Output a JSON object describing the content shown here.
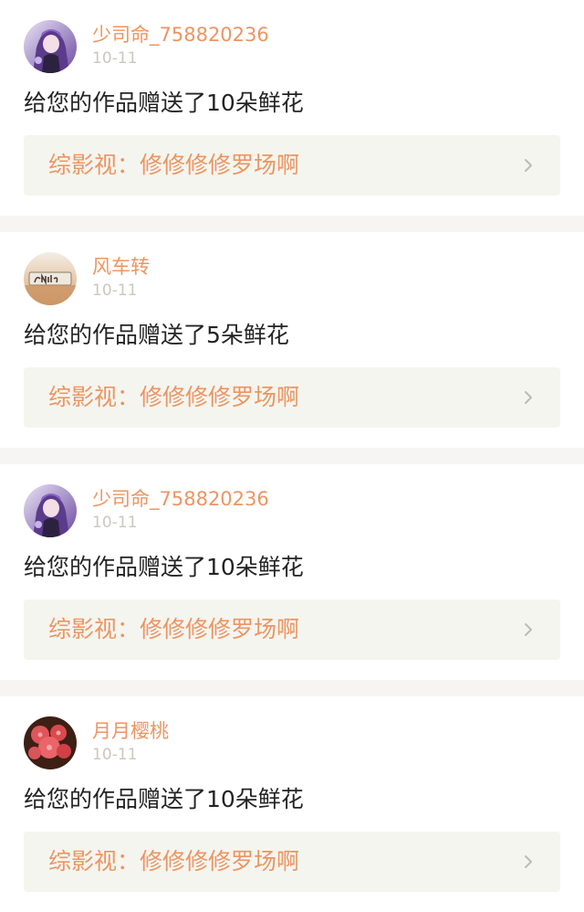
{
  "notifications": [
    {
      "username": "少司命_758820236",
      "date": "10-11",
      "message": "给您的作品赠送了10朵鲜花",
      "work_title": "综影视：修修修修罗场啊",
      "avatar": "anime-girl-avatar"
    },
    {
      "username": "风车转",
      "date": "10-11",
      "message": "给您的作品赠送了5朵鲜花",
      "work_title": "综影视：修修修修罗场啊",
      "avatar": "smile-sign-avatar"
    },
    {
      "username": "少司命_758820236",
      "date": "10-11",
      "message": "给您的作品赠送了10朵鲜花",
      "work_title": "综影视：修修修修罗场啊",
      "avatar": "anime-girl-avatar"
    },
    {
      "username": "月月樱桃",
      "date": "10-11",
      "message": "给您的作品赠送了10朵鲜花",
      "work_title": "综影视：修修修修罗场啊",
      "avatar": "red-flowers-avatar"
    }
  ],
  "colors": {
    "accent": "#ec9562",
    "date": "#cbc7c1",
    "text": "#242424",
    "card_link_bg": "#f5f5ef",
    "separator": "#f7f4f4"
  }
}
